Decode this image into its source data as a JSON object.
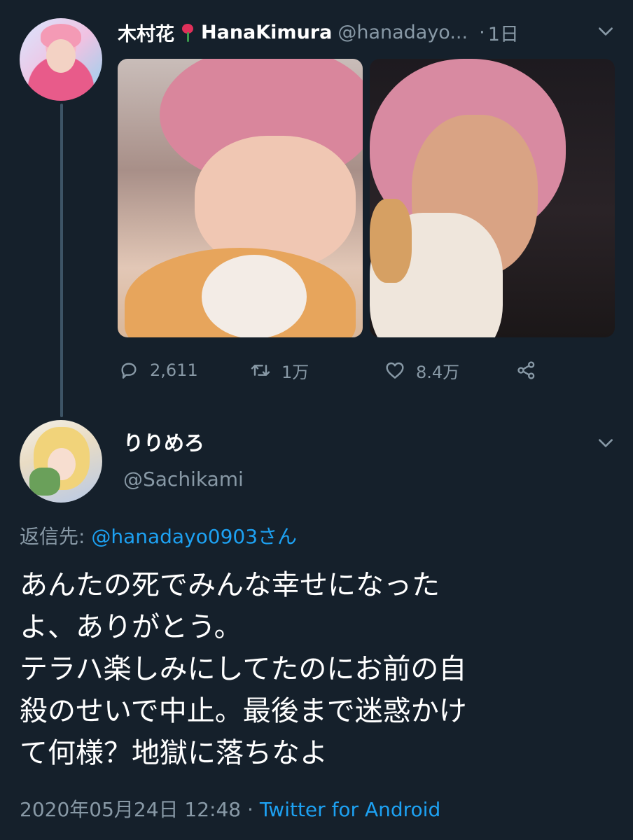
{
  "tweet": {
    "display_name": "木村花",
    "display_name_en": "HanaKimura",
    "handle": "@hanadayo...",
    "separator": "·",
    "time": "1日",
    "actions": {
      "replies": "2,611",
      "retweets": "1万",
      "likes": "8.4万"
    }
  },
  "reply": {
    "display_name": "りりめろ",
    "handle": "@Sachikami",
    "replying_prefix": "返信先:",
    "replying_mention": "@hanadayo0903さん",
    "lines": [
      "あんたの死でみんな幸せになった",
      "よ、ありがとう。",
      "テラハ楽しみにしてたのにお前の自",
      "殺のせいで中止。最後まで迷惑かけ",
      "て何様？地獄に落ちなよ"
    ],
    "timestamp": "2020年05月24日 12:48",
    "separator": "·",
    "source": "Twitter for Android"
  },
  "colors": {
    "background": "#15202b",
    "text": "#ffffff",
    "secondary": "#8899a6",
    "link": "#1da1f2"
  },
  "icons": [
    "flower-icon",
    "chevron-down-icon",
    "reply-icon",
    "retweet-icon",
    "like-icon",
    "share-icon"
  ]
}
